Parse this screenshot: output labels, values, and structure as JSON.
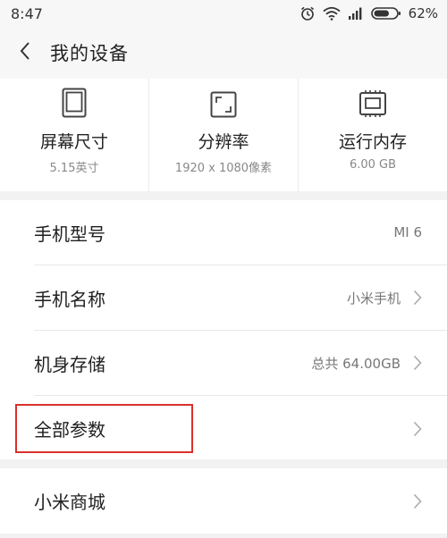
{
  "status_bar": {
    "time": "8:47",
    "battery": "62%",
    "icons": [
      "alarm-icon",
      "wifi-icon",
      "signal-icon",
      "battery-icon"
    ]
  },
  "header": {
    "title": "我的设备",
    "back_icon": "chevron-left-icon"
  },
  "specs": [
    {
      "label": "屏幕尺寸",
      "value": "5.15英寸",
      "icon": "phone-screen-icon"
    },
    {
      "label": "分辨率",
      "value": "1920 x 1080像素",
      "icon": "resolution-icon"
    },
    {
      "label": "运行内存",
      "value": "6.00 GB",
      "icon": "memory-chip-icon"
    }
  ],
  "list": [
    {
      "label": "手机型号",
      "value": "MI 6",
      "has_arrow": false
    },
    {
      "label": "手机名称",
      "value": "小米手机",
      "has_arrow": true
    },
    {
      "label": "机身存储",
      "value": "总共 64.00GB",
      "has_arrow": true
    },
    {
      "label": "全部参数",
      "value": "",
      "has_arrow": true,
      "highlighted": true
    }
  ],
  "list2": [
    {
      "label": "小米商城",
      "value": "",
      "has_arrow": true
    }
  ],
  "colors": {
    "highlight": "#d9302c",
    "background": "#f2f2f2",
    "card": "#ffffff"
  }
}
